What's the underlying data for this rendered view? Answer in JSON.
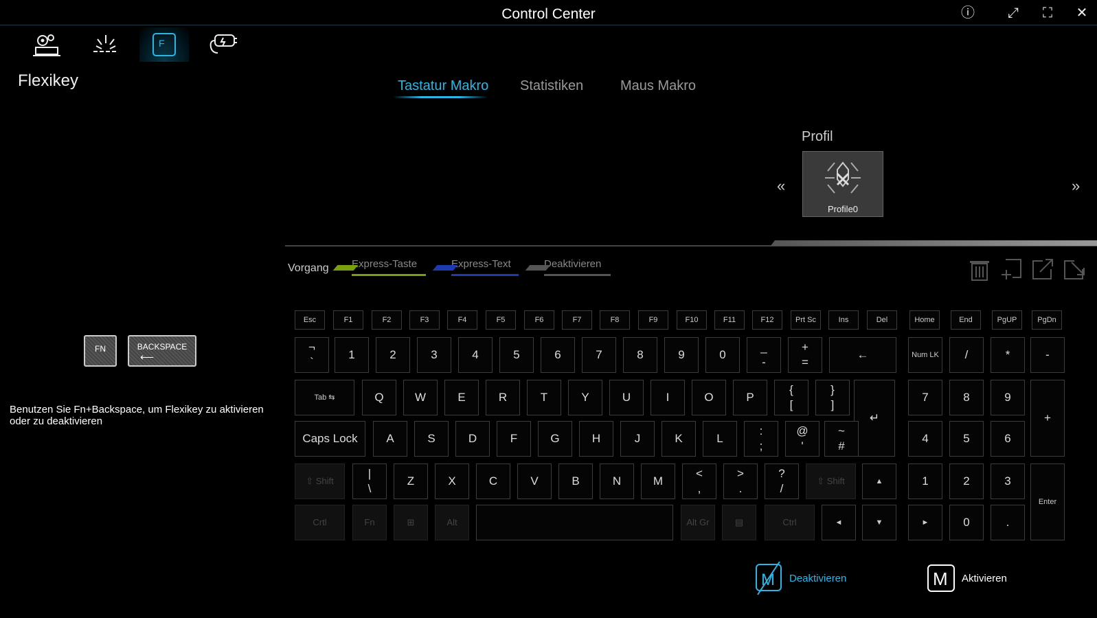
{
  "window": {
    "title": "Control Center",
    "buttons": [
      {
        "name": "info-icon",
        "glyph": "ⓘ"
      },
      {
        "name": "restore-icon",
        "glyph": "⤢"
      },
      {
        "name": "fullscreen-icon",
        "glyph": "⛶"
      },
      {
        "name": "close-icon",
        "glyph": "✕"
      }
    ]
  },
  "nav": {
    "items": [
      {
        "name": "nav-system-settings",
        "icon": "gear-laptop-icon"
      },
      {
        "name": "nav-lighting",
        "icon": "keyboard-light-icon"
      },
      {
        "name": "nav-flexikey",
        "icon": "flexikey-icon",
        "active": true
      },
      {
        "name": "nav-power",
        "icon": "power-plug-icon"
      }
    ]
  },
  "page": {
    "title": "Flexikey"
  },
  "tabs": [
    {
      "label": "Tastatur Makro",
      "active": true
    },
    {
      "label": "Statistiken",
      "active": false
    },
    {
      "label": "Maus Makro",
      "active": false
    }
  ],
  "profile": {
    "label": "Profil",
    "name": "Profile0",
    "prev": "«",
    "next": "»"
  },
  "vorgang": {
    "label": "Vorgang",
    "legend": [
      {
        "label": "Express-Taste",
        "color": "#7aa012"
      },
      {
        "label": "Express-Text",
        "color": "#1d3ab0"
      },
      {
        "label": "Deaktivieren",
        "color": "#555555"
      }
    ]
  },
  "actions": [
    "trash-icon",
    "add-icon",
    "export-icon",
    "import-icon"
  ],
  "left_panel": {
    "fn_key": "FN",
    "backspace_key": "BACKSPACE",
    "hint": "Benutzen Sie Fn+Backspace, um Flexikey zu aktivieren oder zu deaktivieren"
  },
  "keyboard": {
    "row_f": [
      "Esc",
      "F1",
      "F2",
      "F3",
      "F4",
      "F5",
      "F6",
      "F7",
      "F8",
      "F9",
      "F10",
      "F11",
      "F12",
      "Prt Sc",
      "Ins",
      "Del",
      "Home",
      "End",
      "PgUP",
      "PgDn"
    ],
    "row_num": [
      "¬\n`",
      "1",
      "2",
      "3",
      "4",
      "5",
      "6",
      "7",
      "8",
      "9",
      "0",
      "_\n-",
      "+\n=",
      "←",
      "Num LK",
      "/",
      "*",
      "-"
    ],
    "row_q": [
      "Tab ⇆",
      "Q",
      "W",
      "E",
      "R",
      "T",
      "Y",
      "U",
      "I",
      "O",
      "P",
      "{\n[",
      "}\n]",
      "↵",
      "7",
      "8",
      "9",
      "+"
    ],
    "row_a": [
      "Caps Lock",
      "A",
      "S",
      "D",
      "F",
      "G",
      "H",
      "J",
      "K",
      "L",
      ":\n;",
      "@\n'",
      "~\n#",
      "4",
      "5",
      "6"
    ],
    "row_z": [
      "⇧ Shift",
      "|\n\\",
      "Z",
      "X",
      "C",
      "V",
      "B",
      "N",
      "M",
      "<\n,",
      ">\n.",
      "?\n/",
      "⇧ Shift",
      "▲",
      "1",
      "2",
      "3",
      "Enter"
    ],
    "row_ctrl": [
      "Crtl",
      "Fn",
      "⊞",
      "Alt",
      "",
      "Alt Gr",
      "▤",
      "Ctrl",
      "◄",
      "▼",
      "►",
      "0",
      "."
    ]
  },
  "bottom": {
    "deactivate": "Deaktivieren",
    "activate": "Aktivieren",
    "accent": "#2bb6e6"
  }
}
